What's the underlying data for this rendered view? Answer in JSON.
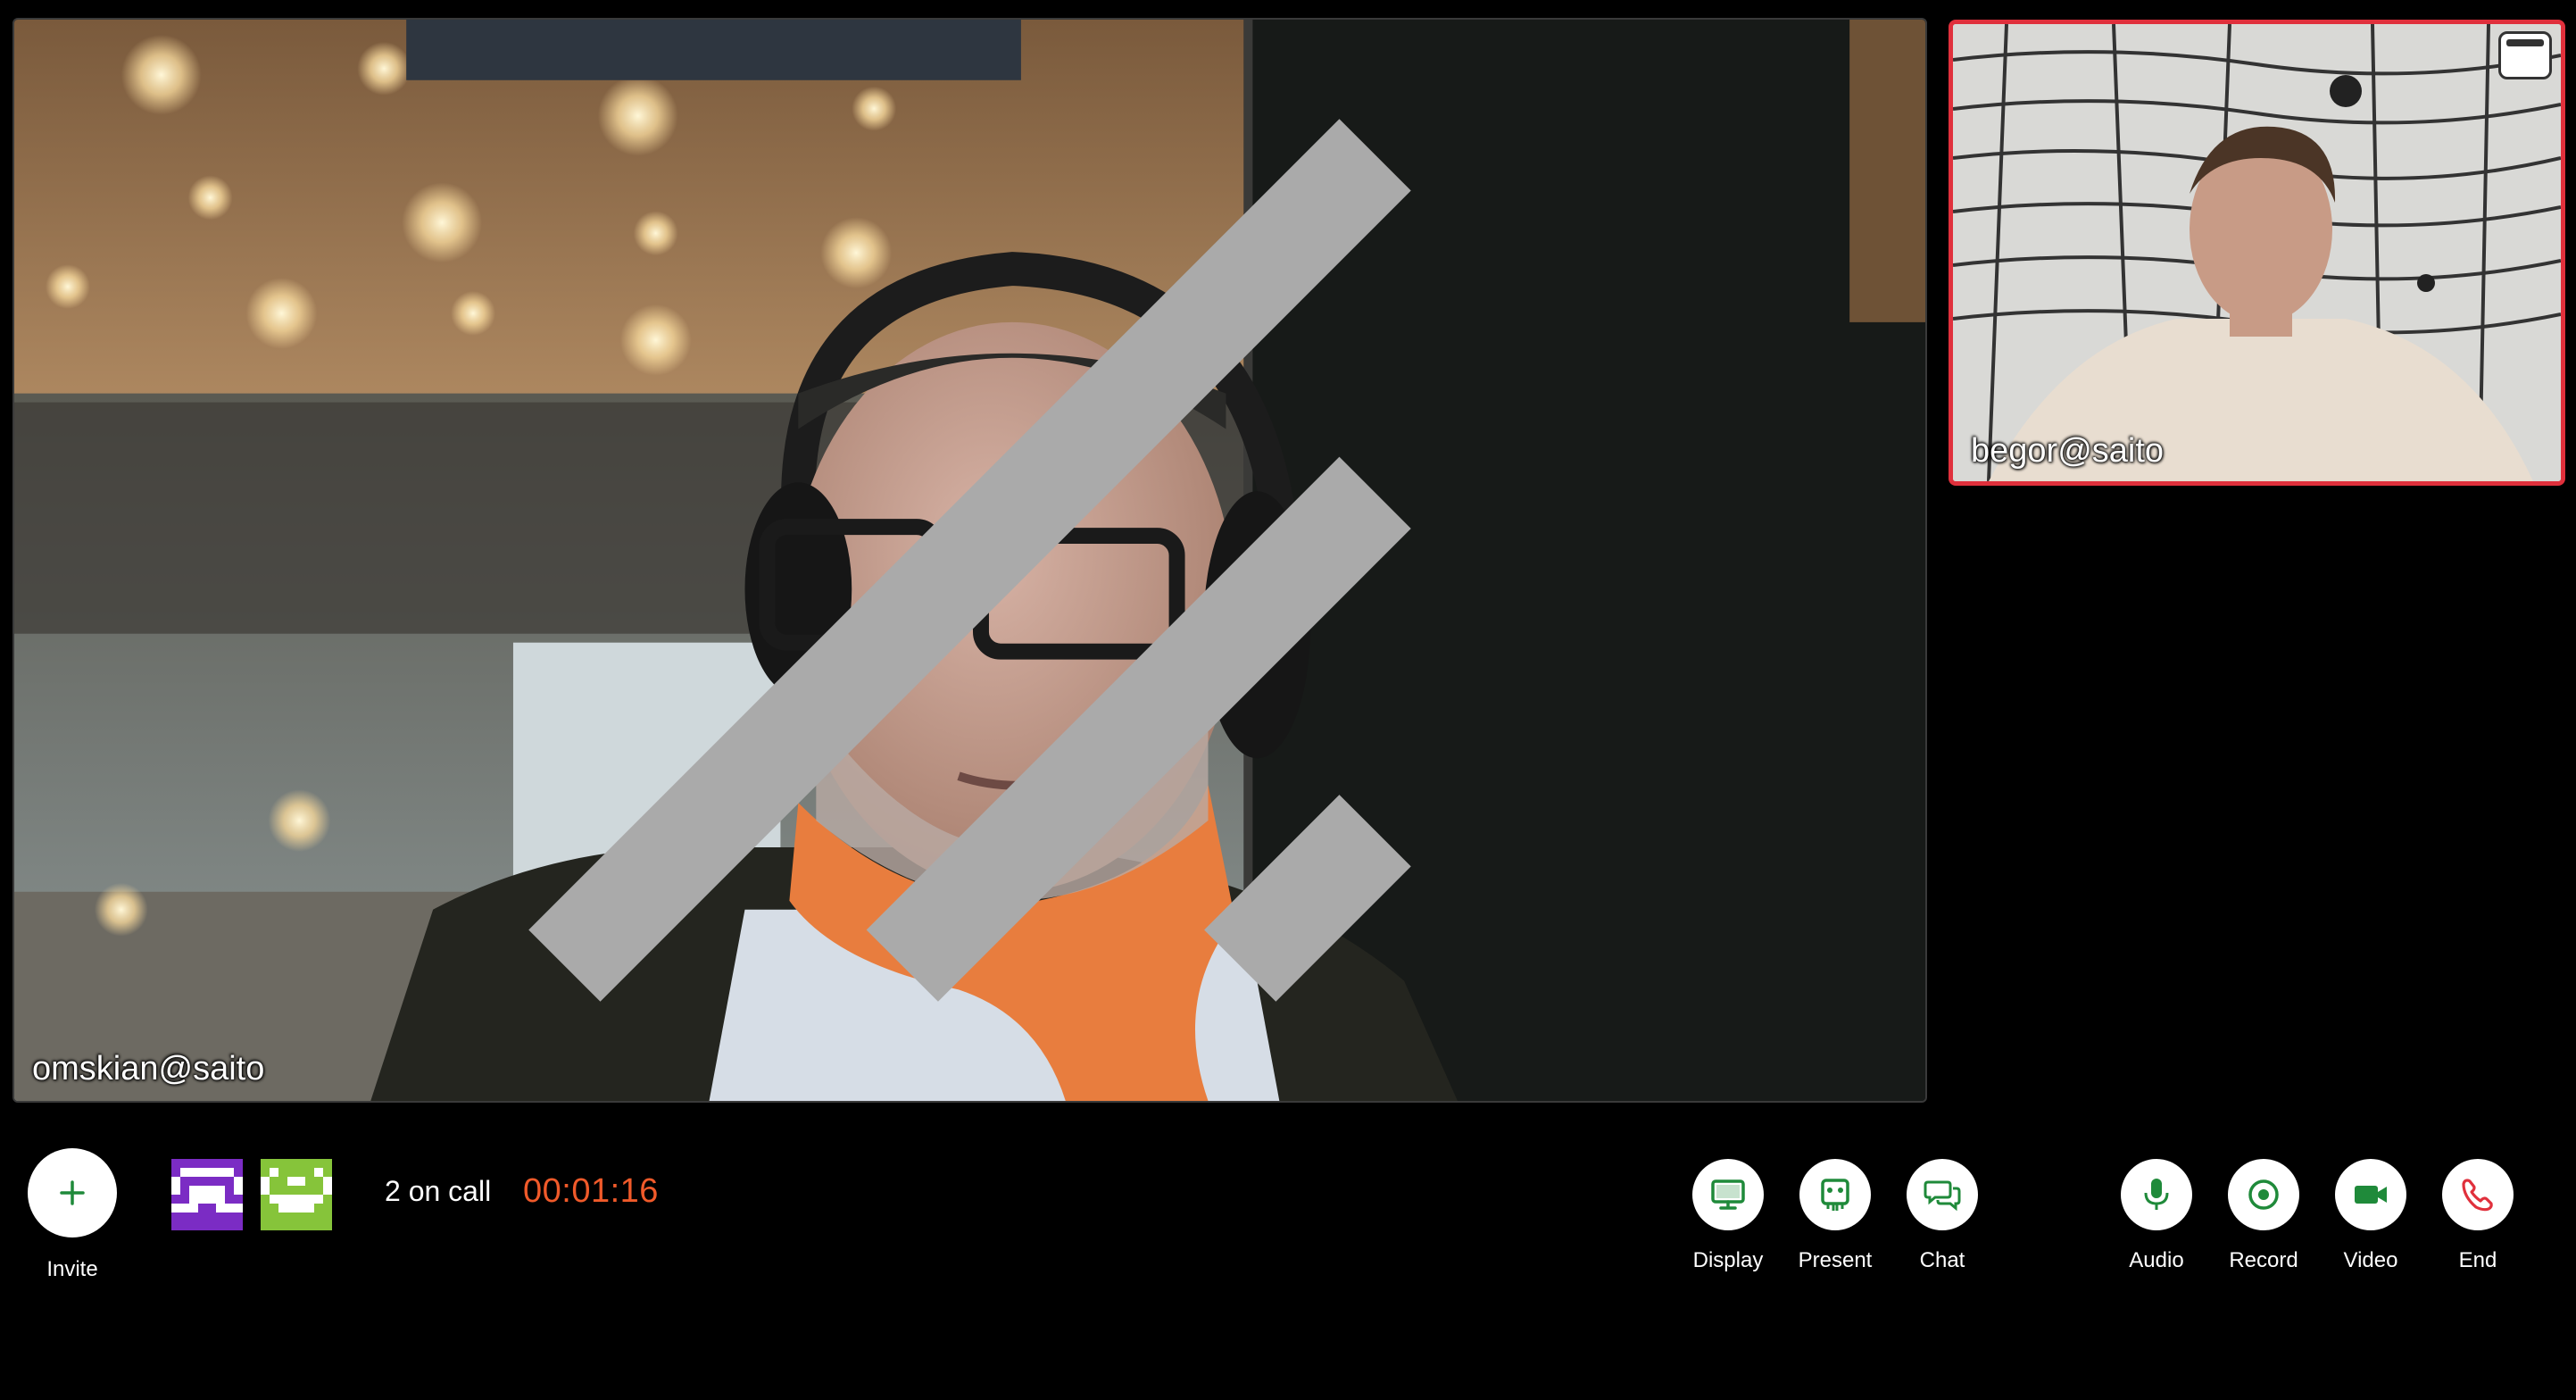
{
  "main_tile": {
    "participant": "omskian@saito"
  },
  "side_tile": {
    "participant": "begor@saito"
  },
  "invite": {
    "label": "Invite"
  },
  "avatars": [
    {
      "name": "purple-pixel-avatar",
      "color": "#7b2cc4"
    },
    {
      "name": "green-pixel-avatar",
      "color": "#86c43a"
    }
  ],
  "call_status": {
    "count_text": "2 on call",
    "elapsed": "00:01:16"
  },
  "controls": {
    "display": {
      "label": "Display",
      "icon": "monitor-icon"
    },
    "present": {
      "label": "Present",
      "icon": "present-icon"
    },
    "chat": {
      "label": "Chat",
      "icon": "chat-icon"
    },
    "audio": {
      "label": "Audio",
      "icon": "microphone-icon"
    },
    "record": {
      "label": "Record",
      "icon": "record-icon"
    },
    "video": {
      "label": "Video",
      "icon": "video-camera-icon"
    },
    "end": {
      "label": "End",
      "icon": "phone-hangup-icon"
    }
  },
  "colors": {
    "accent": "#1f8a3a",
    "end": "#e0303c",
    "timer": "#f05a2a",
    "active_border": "#e0303c"
  }
}
